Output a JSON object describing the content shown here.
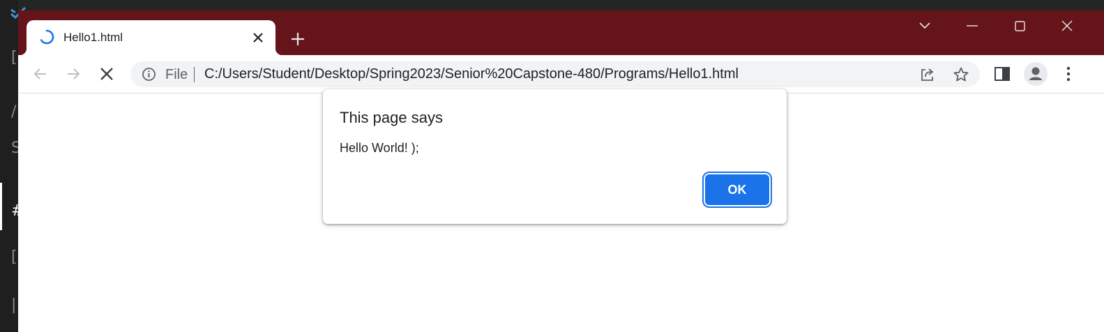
{
  "tab": {
    "title": "Hello1.html"
  },
  "toolbar": {
    "security_label": "File",
    "url": "C:/Users/Student/Desktop/Spring2023/Senior%20Capstone-480/Programs/Hello1.html"
  },
  "dialog": {
    "title": "This page says",
    "message": "Hello World! );",
    "ok_label": "OK"
  },
  "colors": {
    "frame": "#65141a",
    "accent": "#1a73e8",
    "editor_bg": "#1f1f1f"
  },
  "icons": [
    "loading-spinner-icon",
    "close-icon",
    "plus-icon",
    "tab-search-icon",
    "minimize-icon",
    "maximize-icon",
    "window-close-icon",
    "back-arrow-icon",
    "forward-arrow-icon",
    "stop-icon",
    "info-icon",
    "share-icon",
    "star-icon",
    "side-panel-icon",
    "profile-icon",
    "kebab-menu-icon"
  ]
}
